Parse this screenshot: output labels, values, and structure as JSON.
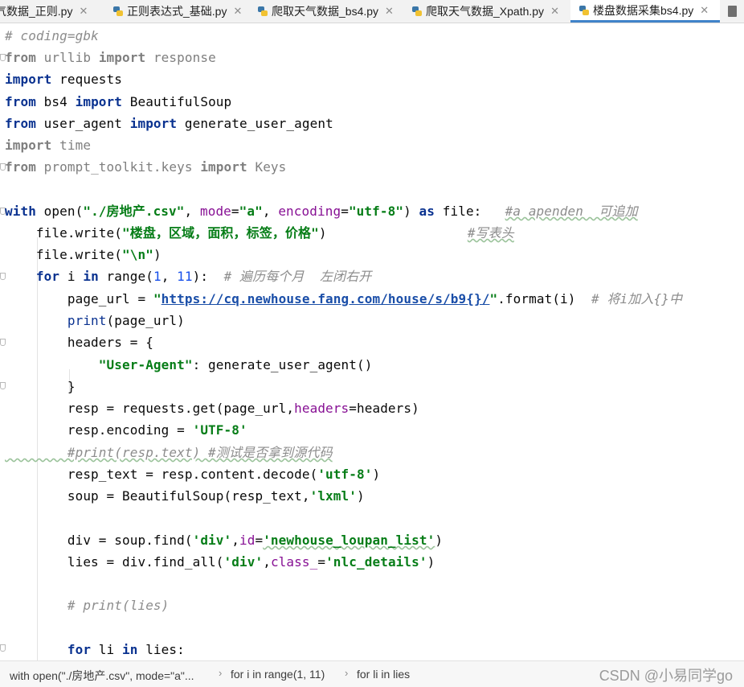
{
  "tabs": [
    {
      "label": "气数据_正则.py",
      "active": false,
      "icon": "python-file-icon"
    },
    {
      "label": "正则表达式_基础.py",
      "active": false,
      "icon": "python-file-icon"
    },
    {
      "label": "爬取天气数据_bs4.py",
      "active": false,
      "icon": "python-file-icon"
    },
    {
      "label": "爬取天气数据_Xpath.py",
      "active": false,
      "icon": "python-file-icon"
    },
    {
      "label": "楼盘数据采集bs4.py",
      "active": true,
      "icon": "python-file-icon"
    }
  ],
  "code": {
    "l1": "# coding=gbk",
    "l2_from": "from",
    "l2_mod": " urllib ",
    "l2_import": "import",
    "l2_name": " response",
    "l3_import": "import",
    "l3_name": " requests",
    "l4_from": "from",
    "l4_mod": " bs4 ",
    "l4_import": "import",
    "l4_name": " BeautifulSoup",
    "l5_from": "from",
    "l5_mod": " user_agent ",
    "l5_import": "import",
    "l5_name": " generate_user_agent",
    "l6_import": "import",
    "l6_name": " time",
    "l7_from": "from",
    "l7_mod": " prompt_toolkit.keys ",
    "l7_import": "import",
    "l7_name": " Keys",
    "l9_with": "with",
    "l9_open": " open(",
    "l9_s1": "\"./房地产.csv\"",
    "l9_a": ", ",
    "l9_mode": "mode",
    "l9_b": "=",
    "l9_s2": "\"a\"",
    "l9_c": ", ",
    "l9_enc": "encoding",
    "l9_d": "=",
    "l9_s3": "\"utf-8\"",
    "l9_e": ") ",
    "l9_as": "as",
    "l9_f": " file:   ",
    "l9_cmt": "#a apenden  可追加",
    "l10_a": "    file.write(",
    "l10_s": "\"楼盘，区域，面积，标签，价格\"",
    "l10_b": ")                  ",
    "l10_cmt": "#写表头",
    "l11_a": "    file.write(",
    "l11_s": "\"\\n\"",
    "l11_b": ")",
    "l12_for": "    for",
    "l12_a": " i ",
    "l12_in": "in",
    "l12_b": " range(",
    "l12_n1": "1",
    "l12_c": ", ",
    "l12_n2": "11",
    "l12_d": "):  ",
    "l12_cmt": "# 遍历每个月  左闭右开",
    "l13_a": "        page_url = ",
    "l13_q1": "\"",
    "l13_url": "https://cq.newhouse.fang.com/house/s/b9{}/",
    "l13_q2": "\"",
    "l13_b": ".format(i)  ",
    "l13_cmt": "# 将i加入{}中",
    "l14_print": "        print",
    "l14_a": "(page_url)",
    "l15_a": "        headers = {",
    "l16_s": "            \"User-Agent\"",
    "l16_a": ": generate_user_agent()",
    "l17_a": "        }",
    "l18_a": "        resp = requests.get(page_url,",
    "l18_p": "headers",
    "l18_b": "=headers)",
    "l19_a": "        resp.encoding = ",
    "l19_s": "'UTF-8'",
    "l20_cmt": "        #print(resp.text) #测试是否拿到源代码",
    "l21_a": "        resp_text = resp.content.decode(",
    "l21_s": "'utf-8'",
    "l21_b": ")",
    "l22_a": "        soup = BeautifulSoup(resp_text,",
    "l22_s": "'lxml'",
    "l22_b": ")",
    "l24_a": "        div = soup.find(",
    "l24_s1": "'div'",
    "l24_b": ",",
    "l24_p": "id",
    "l24_c": "=",
    "l24_s2": "'newhouse_loupan_list'",
    "l24_d": ")",
    "l25_a": "        lies = div.find_all(",
    "l25_s1": "'div'",
    "l25_b": ",",
    "l25_p": "class_",
    "l25_c": "=",
    "l25_s2": "'nlc_details'",
    "l25_d": ")",
    "l27_cmt": "        # print(lies)",
    "l29_for": "        for",
    "l29_a": " li ",
    "l29_in": "in",
    "l29_b": " lies:"
  },
  "breadcrumbs": [
    "with open(\"./房地产.csv\", mode=\"a\"...",
    "for i in range(1, 11)",
    "for li in lies"
  ],
  "watermark": "CSDN @小易同学go"
}
